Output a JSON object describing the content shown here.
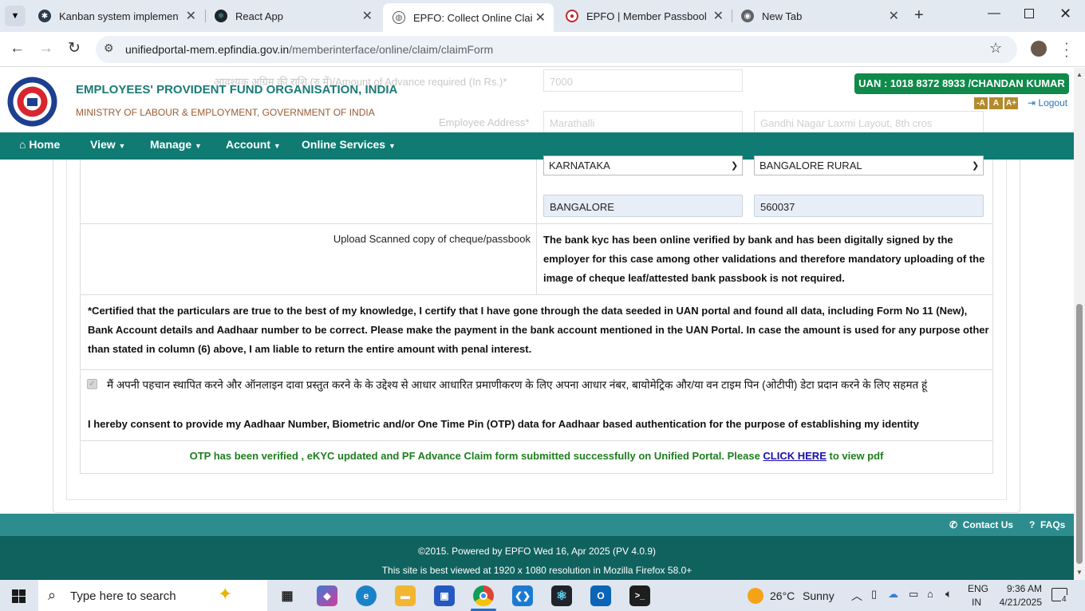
{
  "browser": {
    "tabs": [
      {
        "title": "Kanban system implementat",
        "favicon": "chatgpt-icon",
        "active": false
      },
      {
        "title": "React App",
        "favicon": "react-icon",
        "active": false
      },
      {
        "title": "EPFO: Collect Online Claim F",
        "favicon": "globe-icon",
        "active": true
      },
      {
        "title": "EPFO | Member Passbook",
        "favicon": "epfo-icon",
        "active": false
      },
      {
        "title": "New Tab",
        "favicon": "chrome-icon",
        "active": false
      }
    ],
    "url_host": "unifiedportal-mem.epfindia.gov.in",
    "url_path": "/memberinterface/online/claim/claimForm"
  },
  "header": {
    "org_name": "EMPLOYEES' PROVIDENT FUND ORGANISATION, INDIA",
    "ministry": "MINISTRY OF LABOUR & EMPLOYMENT, GOVERNMENT OF INDIA",
    "uan_badge": "UAN : 1018 8372 8933 /CHANDAN KUMAR",
    "font_small": "-A",
    "font_normal": "A",
    "font_large": "A+",
    "logout": "Logout",
    "ghost_amount_label": "आवश्यक अग्रिम की राशि (रु में)/Amount of Advance required (In Rs.)*",
    "ghost_amount_value": "7000",
    "ghost_address_label": "Employee Address*",
    "ghost_address_1": "Marathalli",
    "ghost_address_2": "Gandhi Nagar Laxmi Layout, 8th cros"
  },
  "nav": {
    "home": "Home",
    "view": "View",
    "manage": "Manage",
    "account": "Account",
    "online_services": "Online Services"
  },
  "form": {
    "state": "KARNATAKA",
    "district": "BANGALORE RURAL",
    "city": "BANGALORE",
    "pincode": "560037",
    "upload_label": "Upload Scanned copy of cheque/passbook",
    "kyc_note": "The bank kyc has been online verified by bank and has been digitally signed by the employer for this case among other validations and therefore mandatory uploading of the image of cheque leaf/attested bank passbook is not required.",
    "certification": "*Certified that the particulars are true to the best of my knowledge, I certify that I have gone through the data seeded in UAN portal and found all data, including Form No 11 (New), Bank Account details and Aadhaar number to be correct. Please make the payment in the bank account mentioned in the UAN Portal. In case the amount is used for any purpose other than stated in column (6) above, I am liable to return the entire amount with penal interest.",
    "consent_hindi": "मैं अपनी पहचान स्थापित करने और ऑनलाइन दावा प्रस्तुत करने के के उद्देश्य से आधार आधारित प्रमाणीकरण के लिए अपना आधार नंबर, बायोमेट्रिक और/या वन टाइम पिन (ओटीपी) डेटा प्रदान करने के लिए सहमत हूं",
    "consent_english": "I hereby consent to provide my Aadhaar Number, Biometric and/or One Time Pin (OTP) data for Aadhaar based authentication for the purpose of establishing my identity",
    "consent_checked": true,
    "success_msg": "OTP has been verified , eKYC updated and PF Advance Claim form submitted successfully on Unified Portal. Please",
    "click_here": "CLICK HERE",
    "success_tail": "to view pdf"
  },
  "footer": {
    "contact_us": "Contact Us",
    "faqs": "FAQs",
    "copyright": "©2015. Powered by EPFO Wed 16, Apr 2025 (PV 4.0.9)",
    "best_viewed": "This site is best viewed at 1920 x 1080 resolution in Mozilla Firefox 58.0+"
  },
  "taskbar": {
    "search_placeholder": "Type here to search",
    "weather_temp": "26°C",
    "weather_desc": "Sunny",
    "lang_top": "ENG",
    "lang_bottom": "IN",
    "time": "9:36 AM",
    "date": "4/21/2025",
    "notif_count": "4"
  },
  "colors": {
    "nav_bg": "#0f7b73",
    "uan_green": "#0f8a4a",
    "success_green": "#1e7e1e",
    "link_blue": "#1a0dab"
  }
}
